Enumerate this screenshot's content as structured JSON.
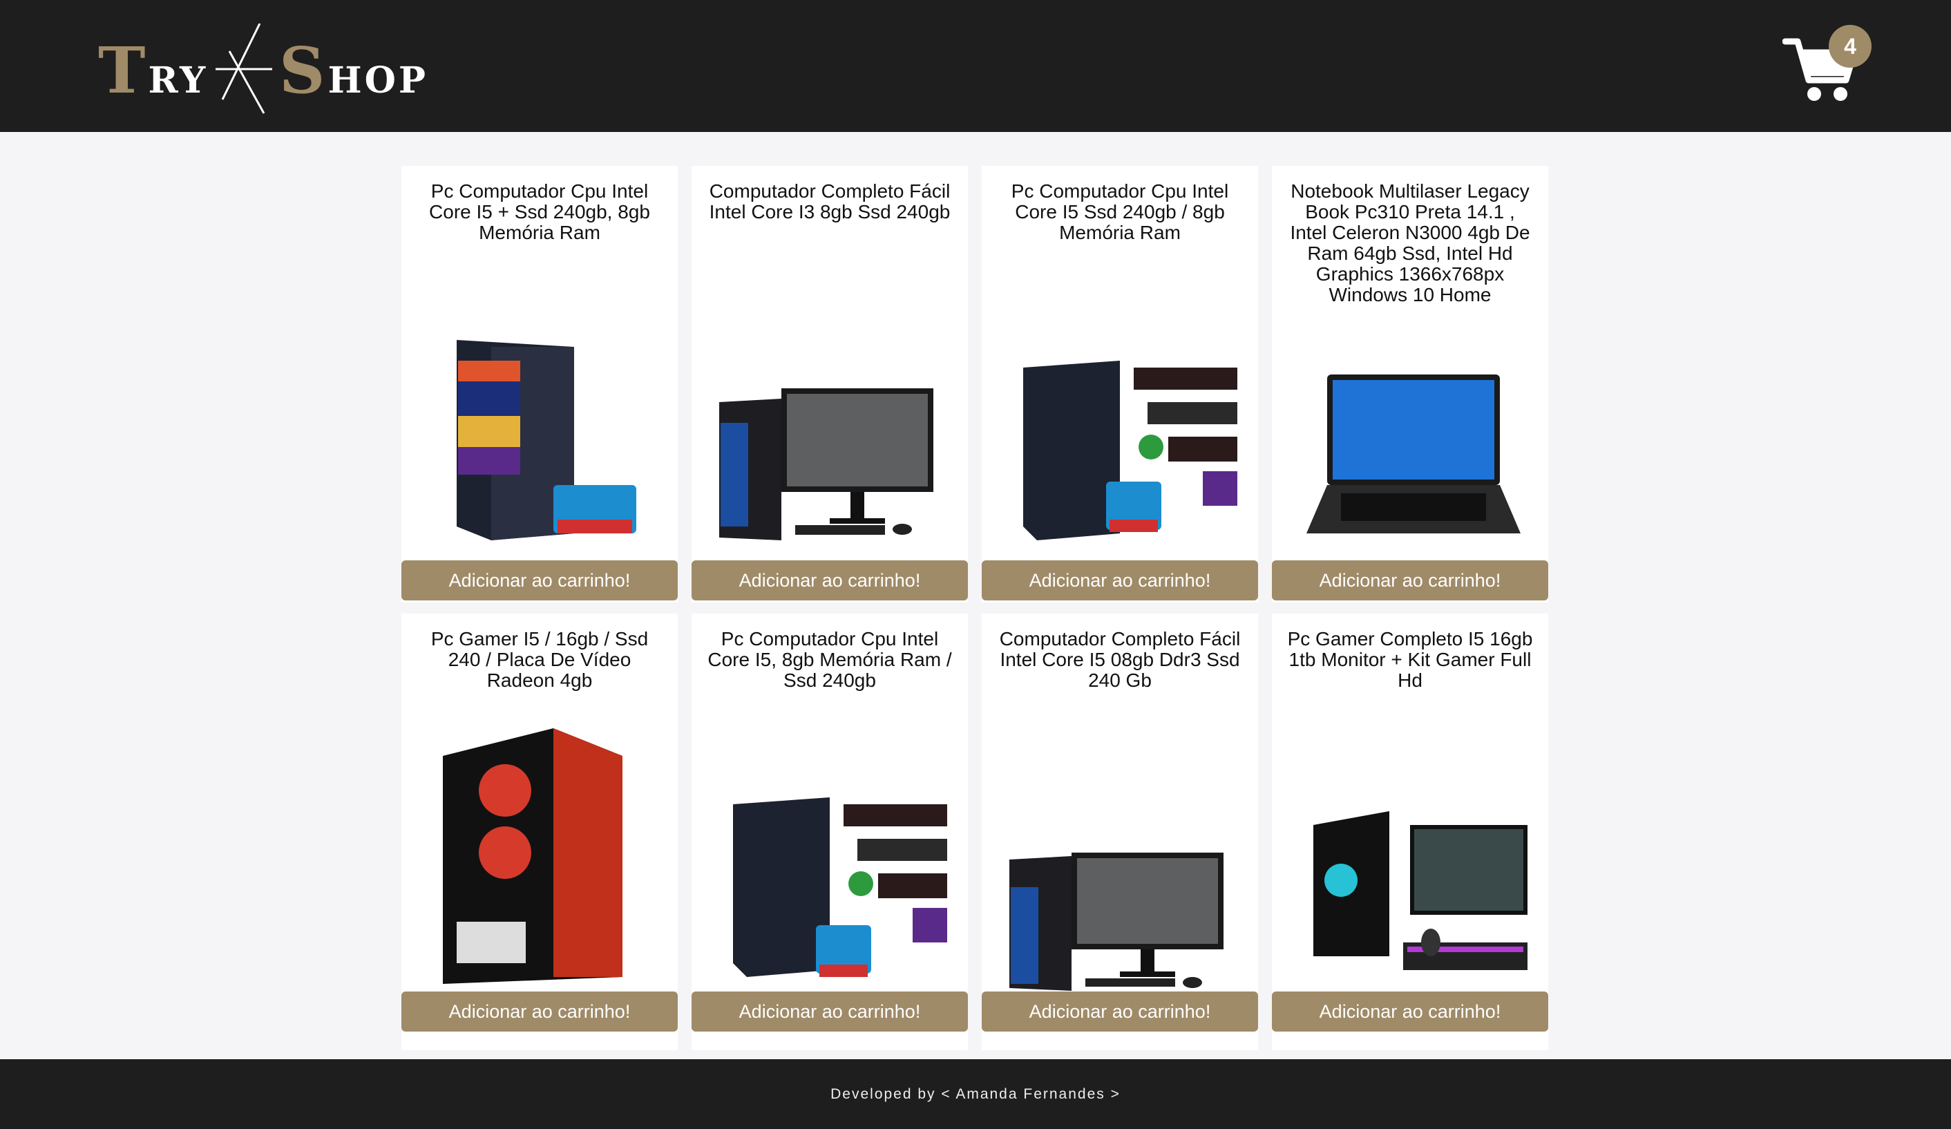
{
  "header": {
    "logo": {
      "part1_big": "T",
      "part1_small": "RY",
      "part2_big": "S",
      "part2_small": "HOP"
    },
    "cart_count": "4",
    "cart_icon": "shopping-cart-icon"
  },
  "products": [
    {
      "title": "Pc Computador Cpu Intel Core I5 + Ssd 240gb, 8gb Memória Ram",
      "button": "Adicionar ao carrinho!",
      "image": "pc-tower-intel-i5"
    },
    {
      "title": "Computador Completo Fácil Intel Core I3 8gb Ssd 240gb",
      "button": "Adicionar ao carrinho!",
      "image": "pc-tower-monitor"
    },
    {
      "title": "Pc Computador Cpu Intel Core I5 Ssd 240gb / 8gb Memória Ram",
      "button": "Adicionar ao carrinho!",
      "image": "pc-tower-intel-i5"
    },
    {
      "title": "Notebook Multilaser Legacy Book Pc310 Preta 14.1 , Intel Celeron N3000 4gb De Ram 64gb Ssd, Intel Hd Graphics 1366x768px Windows 10 Home",
      "button": "Adicionar ao carrinho!",
      "image": "notebook"
    },
    {
      "title": "Pc Gamer I5 / 16gb / Ssd 240 / Placa De Vídeo Radeon 4gb",
      "button": "Adicionar ao carrinho!",
      "image": "gamer-tower"
    },
    {
      "title": "Pc Computador Cpu Intel Core I5, 8gb Memória Ram / Ssd 240gb",
      "button": "Adicionar ao carrinho!",
      "image": "pc-tower-intel-i5"
    },
    {
      "title": "Computador Completo Fácil Intel Core I5 08gb Ddr3 Ssd 240 Gb",
      "button": "Adicionar ao carrinho!",
      "image": "pc-tower-monitor"
    },
    {
      "title": "Pc Gamer Completo I5 16gb 1tb Monitor + Kit Gamer Full Hd",
      "button": "Adicionar ao carrinho!",
      "image": "gamer-kit"
    }
  ],
  "footer": {
    "text": "Developed by < Amanda Fernandes >"
  },
  "colors": {
    "header_bg": "#1f1e1e",
    "accent": "#a08b68",
    "page_bg": "#f5f5f7"
  }
}
